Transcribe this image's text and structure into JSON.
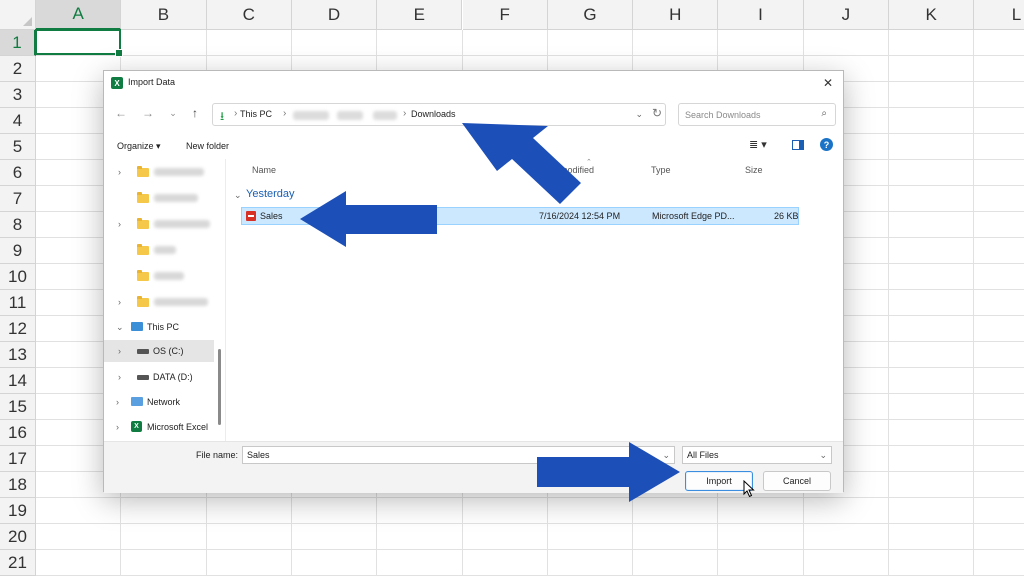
{
  "sheet": {
    "columns": [
      "A",
      "B",
      "C",
      "D",
      "E",
      "F",
      "G",
      "H",
      "I",
      "J",
      "K",
      "L"
    ],
    "rows": [
      "1",
      "2",
      "3",
      "4",
      "5",
      "6",
      "7",
      "8",
      "9",
      "10",
      "11",
      "12",
      "13",
      "14",
      "15",
      "16",
      "17",
      "18",
      "19",
      "20",
      "21"
    ],
    "active_cell": "A1"
  },
  "dialog": {
    "title": "Import Data",
    "nav": {
      "path": [
        "This PC",
        "Downloads"
      ],
      "search_placeholder": "Search Downloads"
    },
    "toolbar": {
      "organize": "Organize",
      "new_folder": "New folder"
    },
    "sidebar": {
      "this_pc": "This PC",
      "drive_c": "OS (C:)",
      "drive_d": "DATA (D:)",
      "network": "Network",
      "excel": "Microsoft Excel"
    },
    "columns": {
      "name": "Name",
      "modified": "modified",
      "type": "Type",
      "size": "Size"
    },
    "group": "Yesterday",
    "files": [
      {
        "name": "Sales",
        "date": "7/16/2024 12:54 PM",
        "type": "Microsoft Edge PD...",
        "size": "26 KB"
      }
    ],
    "file_name_label": "File name:",
    "file_name_value": "Sales",
    "file_type": "All Files",
    "import_button": "Import",
    "cancel_button": "Cancel"
  },
  "colors": {
    "excel_green": "#107c41",
    "arrow_blue": "#1c4fb8",
    "selection": "#cce8ff"
  }
}
